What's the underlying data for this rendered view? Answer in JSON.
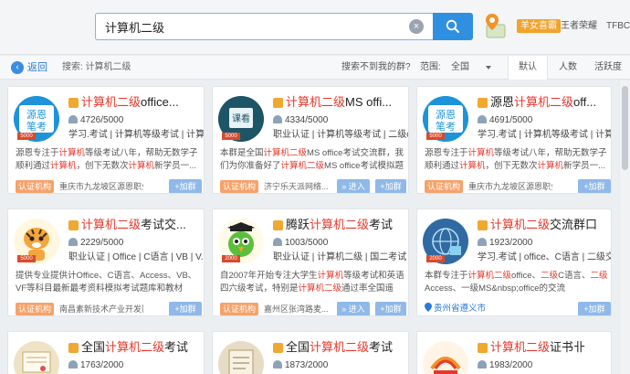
{
  "search": {
    "value": "计算机二级",
    "clear_glyph": "×"
  },
  "header": {
    "vip_badge": "羊女喜霸",
    "user_name": "王者荣耀",
    "tag": "TFBC"
  },
  "filter": {
    "back_label": "返回",
    "search_label": "搜索:",
    "search_term": "计算机二级",
    "not_found": "搜索不到我的群?",
    "range_label": "范围:",
    "range_value": "全国",
    "tabs": [
      "默认",
      "人数",
      "活跃度"
    ]
  },
  "icons": {
    "search": "search-icon",
    "location": "location-pin-icon",
    "back": "back-arrow-icon"
  },
  "colors": {
    "accent": "#2f8fe0",
    "highlight": "#e7372a",
    "cert": "#f6a26a",
    "button": "#8fb9e8",
    "vip": "#f2a32a"
  },
  "cards": [
    {
      "avatar": "源恩笔考",
      "level": "5000",
      "title_pre": "",
      "title_hl": "计算机二级",
      "title_post": "office...",
      "members": "4726/5000",
      "tags": "学习.考试 | 计算机等级考试 | 计算...",
      "desc_a": "源恩专注于",
      "desc_hl1": "计算机",
      "desc_b": "等级考试八年，帮助无数学子顺利通过",
      "desc_hl2": "计算机",
      "desc_c": "，创下无数次",
      "desc_hl3": "计算机",
      "desc_d": "新学员一...",
      "cert": "认证机构",
      "org": "重庆市九龙坡区源恩职业培...",
      "enter": "",
      "add": "+加群"
    },
    {
      "avatar": "课看",
      "level": "5000",
      "title_pre": "",
      "title_hl": "计算机二级",
      "title_post": "MS offi...",
      "members": "4334/5000",
      "tags": "职业认证 | 计算机等级考试 | 二级office",
      "desc_a": "本群是全国",
      "desc_hl1": "计算机二级",
      "desc_b": "MS office考试交流群，我们为你准备好了",
      "desc_hl2": "计算机二级",
      "desc_c": "MS office考试模拟题库...",
      "desc_hl3": "",
      "desc_d": "",
      "cert": "认证机构",
      "org": "济宁乐天派网络...",
      "enter": "» 进入",
      "add": "+加群"
    },
    {
      "avatar": "源恩笔考",
      "level": "5000",
      "title_pre": "源恩",
      "title_hl": "计算机二级",
      "title_post": "off...",
      "members": "4691/5000",
      "tags": "学习.考试 | 计算机等级考试 | 计算...",
      "desc_a": "源恩专注于",
      "desc_hl1": "计算机",
      "desc_b": "等级考试八年，帮助无数学子顺利通过",
      "desc_hl2": "计算机",
      "desc_c": "，创下无数次",
      "desc_hl3": "计算机",
      "desc_d": "新学员一...",
      "cert": "认证机构",
      "org": "重庆市九龙坡区源恩职业培...",
      "enter": "",
      "add": "+加群"
    },
    {
      "avatar": "tiger",
      "level": "5000",
      "title_pre": "",
      "title_hl": "计算机二级",
      "title_post": "考试交...",
      "members": "2229/5000",
      "tags": "职业认证 | Office | C语言 | VB | V...",
      "desc_a": "提供专业提供计Office、C语言、Access、VB、VF等科目最新最考资料模拟考试",
      "desc_hl1": "",
      "desc_b": "题库和教材",
      "desc_hl2": "",
      "desc_c": "",
      "desc_hl3": "",
      "desc_d": "",
      "cert": "认证机构",
      "org": "南昌素新技术产业开发区骏...",
      "enter": "",
      "add": "+加群"
    },
    {
      "avatar": "parrot",
      "level": "2000",
      "title_pre": "腾跃",
      "title_hl": "计算机二级",
      "title_post": "考试",
      "members": "1003/5000",
      "tags": "职业认证 | 计算机二级 | 国二考试 |...",
      "desc_a": "自2007年开始专注大学生",
      "desc_hl1": "计算机",
      "desc_b": "等级考试和英语四六级考试，特别是",
      "desc_hl2": "计算机二级",
      "desc_c": "通过率全国遥遥...",
      "desc_hl3": "",
      "desc_d": "",
      "cert": "认证机构",
      "org": "嘉州区张湾路麦...",
      "enter": "» 进入",
      "add": "+加群"
    },
    {
      "avatar": "globe",
      "level": "2000",
      "title_pre": "",
      "title_hl": "计算机二级",
      "title_post": "交流群口",
      "members": "1923/2000",
      "tags": "学习.考试 | office、C语言 | 二级交...",
      "desc_a": "本群专注于",
      "desc_hl1": "计算机二级",
      "desc_b": "office、",
      "desc_hl2": "二级",
      "desc_c": "C语言、",
      "desc_hl3": "二级",
      "desc_d": "Access、一级MS&nbsp;office的交流",
      "cert": "",
      "org": "",
      "addr": "贵州省遵义市",
      "enter": "",
      "add": "+加群"
    },
    {
      "avatar": "certificate",
      "level": "",
      "title_pre": "全国",
      "title_hl": "计算机二级",
      "title_post": "考试",
      "members": "1763/2000",
      "tags": "",
      "desc_a": "",
      "desc_hl1": "",
      "desc_b": "",
      "desc_hl2": "",
      "desc_c": "",
      "desc_hl3": "",
      "desc_d": "",
      "cert": "",
      "org": "",
      "enter": "",
      "add": ""
    },
    {
      "avatar": "scroll",
      "level": "",
      "title_pre": "全国",
      "title_hl": "计算机二级",
      "title_post": "考试",
      "members": "1873/2000",
      "tags": "",
      "desc_a": "",
      "desc_hl1": "",
      "desc_b": "",
      "desc_hl2": "",
      "desc_c": "",
      "desc_hl3": "",
      "desc_d": "",
      "cert": "",
      "org": "",
      "enter": "",
      "add": ""
    },
    {
      "avatar": "school",
      "level": "",
      "title_pre": "",
      "title_hl": "计算机二级",
      "title_post": "证书卝",
      "members": "1983/2000",
      "tags": "",
      "desc_a": "",
      "desc_hl1": "",
      "desc_b": "",
      "desc_hl2": "",
      "desc_c": "",
      "desc_hl3": "",
      "desc_d": "",
      "cert": "",
      "org": "",
      "enter": "",
      "add": ""
    }
  ]
}
